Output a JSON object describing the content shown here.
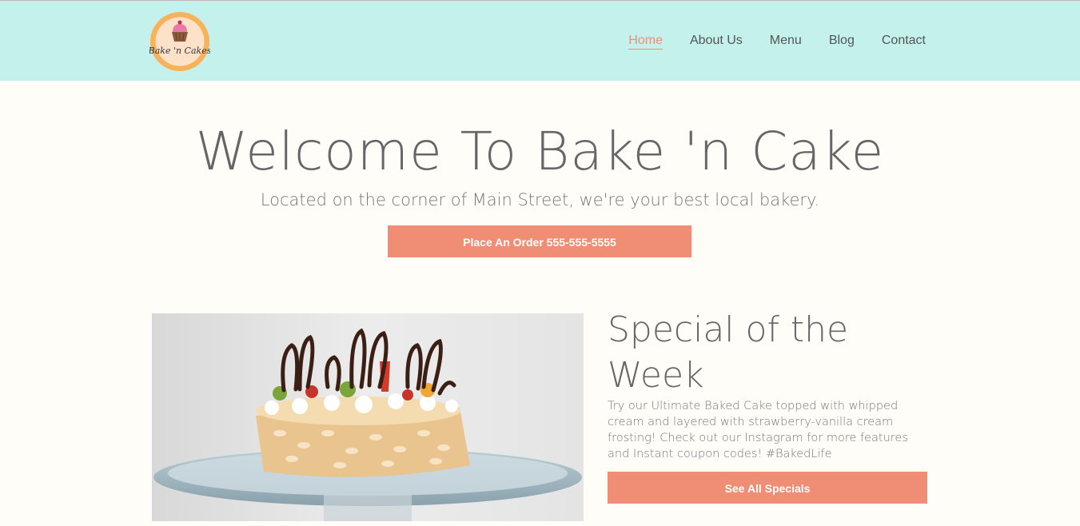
{
  "brand": {
    "logo_text": "Bake 'n Cakes",
    "colors": {
      "header": "#c4f1eb",
      "accent": "#ef8e74",
      "background": "#fffdf8"
    }
  },
  "nav": {
    "items": [
      {
        "label": "Home",
        "active": true
      },
      {
        "label": "About Us"
      },
      {
        "label": "Menu"
      },
      {
        "label": "Blog"
      },
      {
        "label": "Contact"
      }
    ]
  },
  "hero": {
    "title": "Welcome To Bake 'n Cake",
    "subtitle": "Located on the corner of Main Street, we're your best local bakery.",
    "cta_label": "Place An Order 555-555-5555"
  },
  "special": {
    "title": "Special of the Week",
    "text": "Try our Ultimate Baked Cake topped with whipped cream and layered with strawberry-vanilla cream frosting! Check out our Instagram for more features and Instant coupon codes! #BakedLife",
    "cta_label": "See All Specials"
  }
}
